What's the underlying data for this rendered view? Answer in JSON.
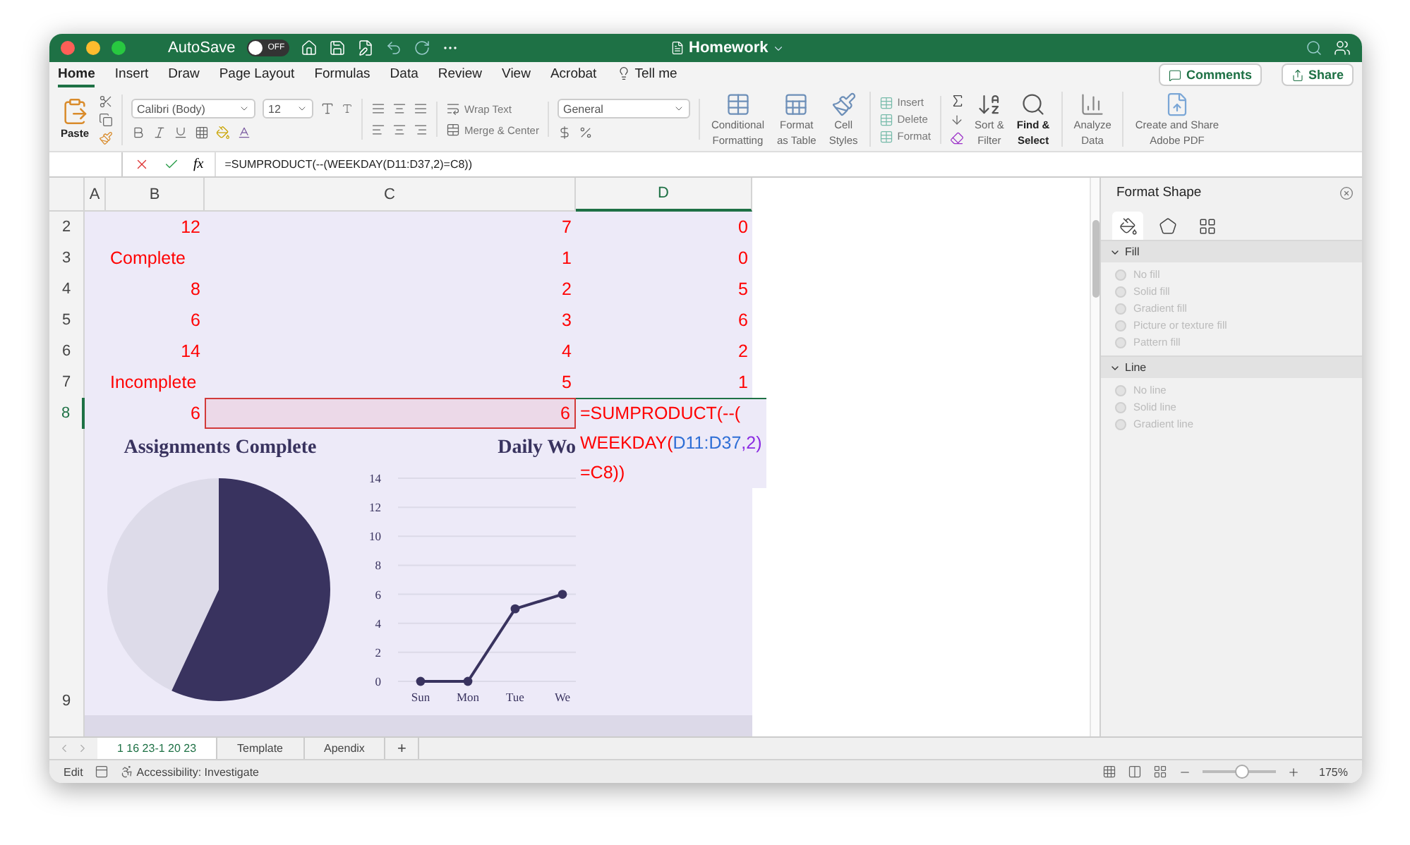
{
  "window": {
    "title": "Homework",
    "autosave_label": "AutoSave",
    "autosave": {
      "on": false,
      "label": "OFF"
    }
  },
  "ribbon_tabs": [
    {
      "label": "Home",
      "selected": true
    },
    {
      "label": "Insert",
      "selected": false
    },
    {
      "label": "Draw",
      "selected": false
    },
    {
      "label": "Page Layout",
      "selected": false
    },
    {
      "label": "Formulas",
      "selected": false
    },
    {
      "label": "Data",
      "selected": false
    },
    {
      "label": "Review",
      "selected": false
    },
    {
      "label": "View",
      "selected": false
    },
    {
      "label": "Acrobat",
      "selected": false
    }
  ],
  "tell_me": "Tell me",
  "header_buttons": {
    "comments": "Comments",
    "share": "Share"
  },
  "ribbon": {
    "paste": "Paste",
    "font": "Calibri (Body)",
    "font_size": "12",
    "wrap_text": "Wrap Text",
    "merge": "Merge & Center",
    "number_format": "General",
    "style_buttons": [
      {
        "kind": "conditional",
        "lines": [
          "Conditional",
          "Formatting"
        ]
      },
      {
        "kind": "table",
        "lines": [
          "Format",
          "as Table"
        ]
      },
      {
        "kind": "styles",
        "lines": [
          "Cell",
          "Styles"
        ]
      }
    ],
    "cell_buttons": [
      "Insert",
      "Delete",
      "Format"
    ],
    "edit_buttons": [
      {
        "kind": "sort",
        "lines": [
          "Sort &",
          "Filter"
        ]
      },
      {
        "kind": "find",
        "lines": [
          "Find &",
          "Select"
        ]
      }
    ],
    "analyze": [
      "Analyze",
      "Data"
    ],
    "pdf": [
      "Create and Share",
      "Adobe PDF"
    ]
  },
  "formula_bar": {
    "fx": "fx",
    "formula": "=SUMPRODUCT(--(WEEKDAY(D11:D37,2)=C8))"
  },
  "sheet": {
    "columns": [
      {
        "label": "A",
        "selected": false
      },
      {
        "label": "B",
        "selected": false
      },
      {
        "label": "C",
        "selected": false
      },
      {
        "label": "D",
        "selected": true
      }
    ],
    "rows": [
      {
        "number": "2",
        "selected": false,
        "cells": [
          {
            "kind": "number",
            "value": "12",
            "referenced": false
          },
          {
            "kind": "number",
            "value": "7",
            "referenced": false
          },
          {
            "kind": "number",
            "value": "0",
            "referenced": false
          }
        ]
      },
      {
        "number": "3",
        "selected": false,
        "cells": [
          {
            "kind": "text",
            "value": "Complete",
            "referenced": false
          },
          {
            "kind": "number",
            "value": "1",
            "referenced": false
          },
          {
            "kind": "number",
            "value": "0",
            "referenced": false
          }
        ]
      },
      {
        "number": "4",
        "selected": false,
        "cells": [
          {
            "kind": "number",
            "value": "8",
            "referenced": false
          },
          {
            "kind": "number",
            "value": "2",
            "referenced": false
          },
          {
            "kind": "number",
            "value": "5",
            "referenced": false
          }
        ]
      },
      {
        "number": "5",
        "selected": false,
        "cells": [
          {
            "kind": "number",
            "value": "6",
            "referenced": false
          },
          {
            "kind": "number",
            "value": "3",
            "referenced": false
          },
          {
            "kind": "number",
            "value": "6",
            "referenced": false
          }
        ]
      },
      {
        "number": "6",
        "selected": false,
        "cells": [
          {
            "kind": "number",
            "value": "14",
            "referenced": false
          },
          {
            "kind": "number",
            "value": "4",
            "referenced": false
          },
          {
            "kind": "number",
            "value": "2",
            "referenced": false
          }
        ]
      },
      {
        "number": "7",
        "selected": false,
        "cells": [
          {
            "kind": "text",
            "value": "Incomplete",
            "referenced": false
          },
          {
            "kind": "number",
            "value": "5",
            "referenced": false
          },
          {
            "kind": "number",
            "value": "1",
            "referenced": false
          }
        ]
      },
      {
        "number": "8",
        "selected": true,
        "cells": [
          {
            "kind": "number",
            "value": "6",
            "referenced": false
          },
          {
            "kind": "number",
            "value": "6",
            "referenced": true
          },
          {
            "kind": "editor",
            "lines": [
              [
                {
                  "text": "=SUMPRODUCT(--(",
                  "color": "#ff0000"
                }
              ],
              [
                {
                  "text": "WEEKDAY(",
                  "color": "#ff0000"
                },
                {
                  "text": "D11:D37",
                  "color": "#2f6fd6"
                },
                {
                  "text": ",2)",
                  "color": "#8a2be2"
                }
              ],
              [
                {
                  "text": "=C8))",
                  "color": "#ff0000"
                }
              ]
            ]
          }
        ]
      }
    ],
    "chart_row": {
      "number": "9",
      "pie": {
        "title": "Assignments Complete"
      },
      "line": {
        "chart_data": {
          "type": "line",
          "title": "Daily Wo",
          "categories": [
            "Sun",
            "Mon",
            "Tue",
            "We"
          ],
          "series": [
            {
              "color": "#39335f",
              "marker": "circle",
              "values": [
                0,
                0,
                5,
                6
              ]
            }
          ],
          "grid": true,
          "ylim": [
            0,
            14
          ],
          "yticks": [
            0,
            2,
            4,
            6,
            8,
            10,
            12,
            14
          ]
        }
      }
    }
  },
  "panel": {
    "title": "Format Shape",
    "tabs": [
      {
        "kind": "fill",
        "selected": true
      },
      {
        "kind": "effects",
        "selected": false
      },
      {
        "kind": "size",
        "selected": false
      }
    ],
    "sections": [
      {
        "title": "Fill",
        "expanded": true,
        "options": [
          {
            "label": "No fill",
            "selected": false,
            "disabled": true
          },
          {
            "label": "Solid fill",
            "selected": false,
            "disabled": true
          },
          {
            "label": "Gradient fill",
            "selected": false,
            "disabled": true
          },
          {
            "label": "Picture or texture fill",
            "selected": false,
            "disabled": true
          },
          {
            "label": "Pattern fill",
            "selected": false,
            "disabled": true
          }
        ]
      },
      {
        "title": "Line",
        "expanded": true,
        "options": [
          {
            "label": "No line",
            "selected": false,
            "disabled": true
          },
          {
            "label": "Solid line",
            "selected": false,
            "disabled": true
          },
          {
            "label": "Gradient line",
            "selected": false,
            "disabled": true
          }
        ]
      }
    ]
  },
  "sheet_tabs": [
    {
      "label": "1 16 23-1 20 23",
      "selected": true
    },
    {
      "label": "Template",
      "selected": false
    },
    {
      "label": "Apendix",
      "selected": false
    }
  ],
  "add_sheet": "+",
  "status_bar": {
    "mode": "Edit",
    "accessibility": "Accessibility: Investigate",
    "zoom": {
      "level": 0.55,
      "label": "175%"
    }
  }
}
